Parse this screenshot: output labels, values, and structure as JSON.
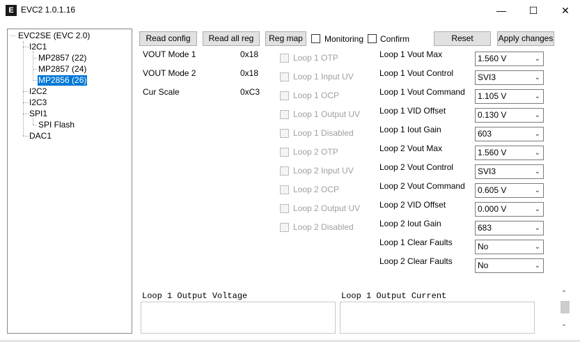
{
  "window": {
    "title": "EVC2 1.0.1.16",
    "icon_letter": "E",
    "minimize_glyph": "—",
    "maximize_glyph": "☐",
    "close_glyph": "✕"
  },
  "tree": {
    "items": [
      {
        "label": "EVC2SE (EVC 2.0)"
      },
      {
        "label": "I2C1"
      },
      {
        "label": "MP2857 (22)"
      },
      {
        "label": "MP2857 (24)"
      },
      {
        "label": "MP2856 (26)"
      },
      {
        "label": "I2C2"
      },
      {
        "label": "I2C3"
      },
      {
        "label": "SPI1"
      },
      {
        "label": "SPI Flash"
      },
      {
        "label": "DAC1"
      }
    ],
    "selected": "MP2856 (26)"
  },
  "toolbar": {
    "read_config": "Read config",
    "read_all_reg": "Read all reg",
    "reg_map": "Reg map",
    "monitoring": "Monitoring",
    "confirm": "Confirm",
    "reset": "Reset",
    "apply_changes": "Apply changes"
  },
  "info": [
    {
      "label": "VOUT Mode 1",
      "value": "0x18"
    },
    {
      "label": "VOUT Mode 2",
      "value": "0x18"
    },
    {
      "label": "Cur Scale",
      "value": "0xC3"
    }
  ],
  "status_flags": [
    "Loop 1 OTP",
    "Loop 1 Input UV",
    "Loop 1 OCP",
    "Loop 1 Output UV",
    "Loop 1 Disabled",
    "Loop 2 OTP",
    "Loop 2 Input UV",
    "Loop 2 OCP",
    "Loop 2 Output UV",
    "Loop 2 Disabled"
  ],
  "settings": [
    {
      "label": "Loop 1 Vout Max",
      "value": "1.560 V"
    },
    {
      "label": "Loop 1 Vout Control",
      "value": "SVI3"
    },
    {
      "label": "Loop 1 Vout Command",
      "value": "1.105 V"
    },
    {
      "label": "Loop 1 VID Offset",
      "value": "0.130 V"
    },
    {
      "label": "Loop 1 Iout Gain",
      "value": "603"
    },
    {
      "label": "Loop 2 Vout Max",
      "value": "1.560 V"
    },
    {
      "label": "Loop 2 Vout Control",
      "value": "SVI3"
    },
    {
      "label": "Loop 2 Vout Command",
      "value": "0.605 V"
    },
    {
      "label": "Loop 2 VID Offset",
      "value": "0.000 V"
    },
    {
      "label": "Loop 2 Iout Gain",
      "value": "683"
    },
    {
      "label": "Loop 1 Clear Faults",
      "value": "No"
    },
    {
      "label": "Loop 2 Clear Faults",
      "value": "No"
    }
  ],
  "plots": {
    "left_title": "Loop 1 Output Voltage",
    "right_title": "Loop 1 Output Current"
  },
  "colors": {
    "selection": "#0078d7",
    "button_bg": "#e1e1e1"
  }
}
